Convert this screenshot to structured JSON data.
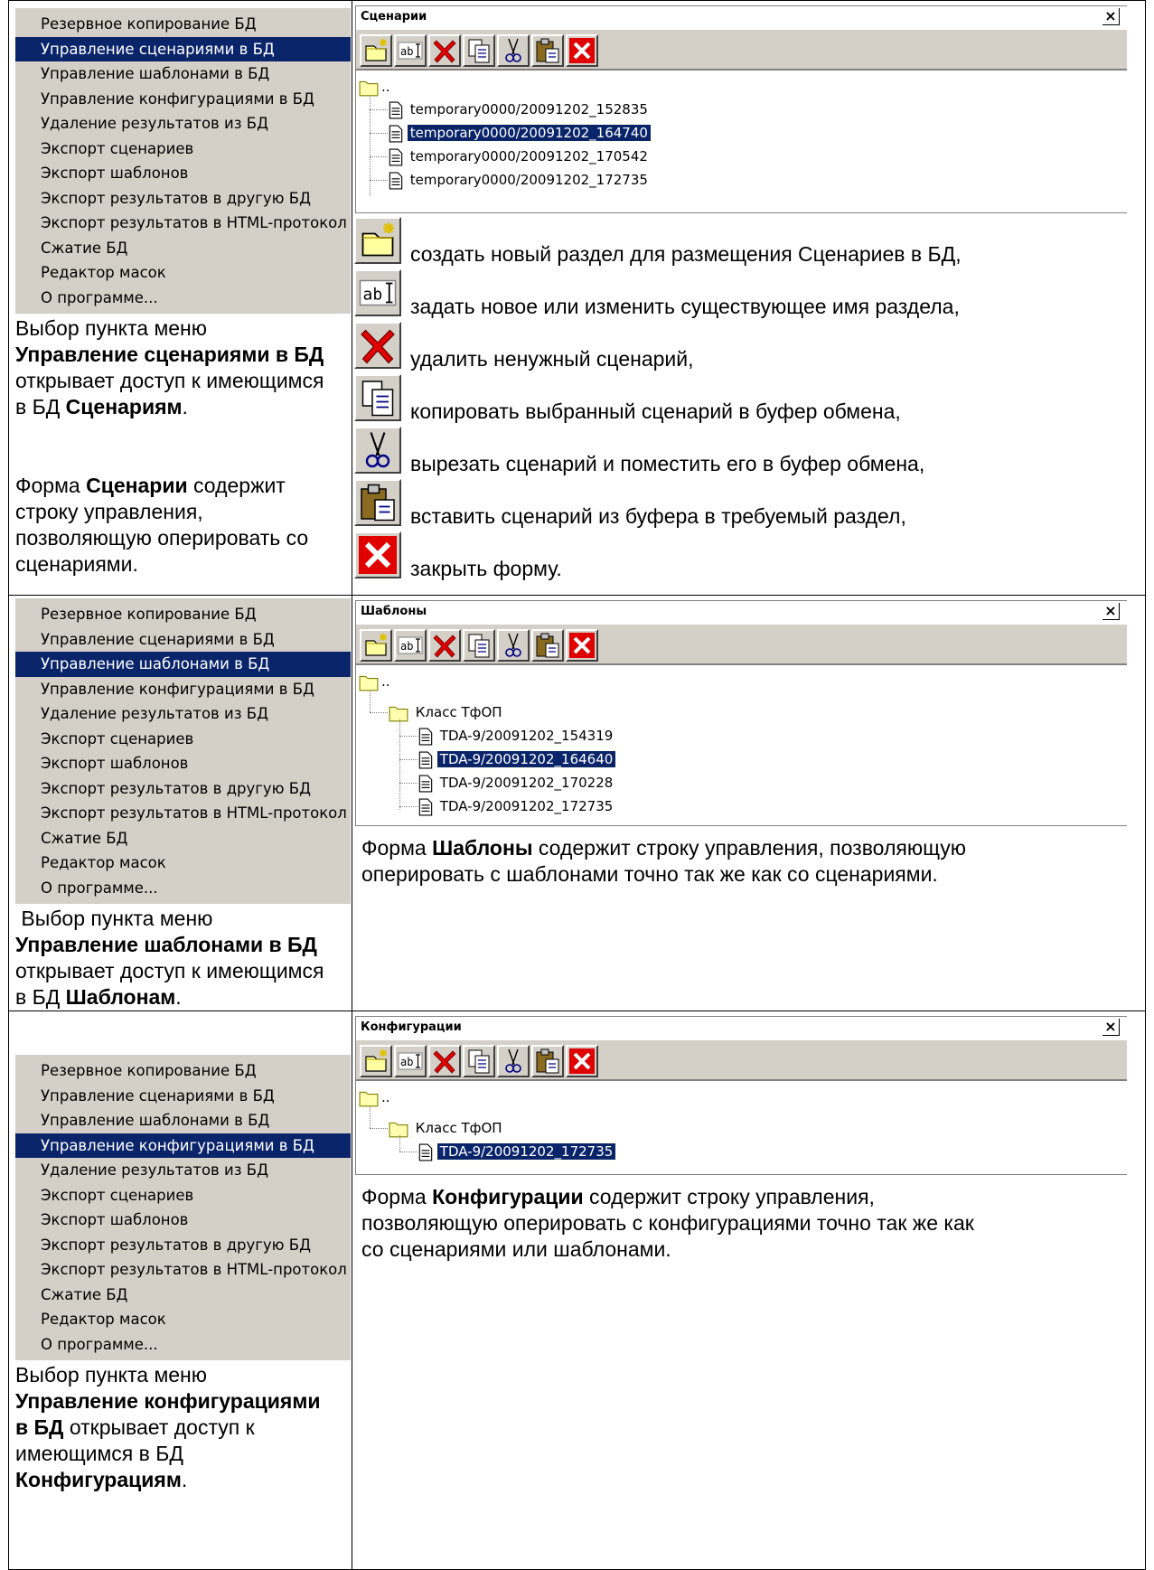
{
  "menu_items": [
    "Резервное копирование БД",
    "Управление сценариями в БД",
    "Управление шаблонами в БД",
    "Управление конфигурациями в БД",
    "Удаление результатов из БД",
    "Экспорт сценариев",
    "Экспорт шаблонов",
    "Экспорт результатов в другую БД",
    "Экспорт результатов в HTML-протокол",
    "Сжатие БД",
    "Редактор масок",
    "О программе..."
  ],
  "row1": {
    "desc": {
      "l1": "Выбор пункта меню",
      "b1": "Управление сценариями в БД",
      "l2": "открывает доступ к имеющимся",
      "l3a": "в БД ",
      "b2": "Сценариям",
      "l3c": "."
    },
    "desc2": {
      "a": "Форма ",
      "b": "Сценарии",
      "c": " содержит",
      "l2": "строку управления,",
      "l3": "позволяющую оперировать со",
      "l4": "сценариями."
    },
    "window_title": "Сценарии",
    "close_x": "×",
    "root": "..",
    "files": [
      "temporary0000/20091202_152835",
      "temporary0000/20091202_164740",
      "temporary0000/20091202_170542",
      "temporary0000/20091202_172735"
    ],
    "legend": [
      "создать новый раздел для размещения Сценариев в БД,",
      "задать новое или изменить существующее имя раздела,",
      "удалить ненужный сценарий,",
      "копировать выбранный сценарий в буфер обмена,",
      "вырезать сценарий и поместить его в буфер обмена,",
      "вставить сценарий из буфера в требуемый раздел,",
      "закрыть форму."
    ]
  },
  "row2": {
    "window_title": "Шаблоны",
    "root": "..",
    "folder": "Класс ТфОП",
    "files": [
      "TDA-9/20091202_154319",
      "TDA-9/20091202_164640",
      "TDA-9/20091202_170228",
      "TDA-9/20091202_172735"
    ],
    "para": {
      "a": "Форма ",
      "b": "Шаблоны",
      "c": " содержит строку управления, позволяющую",
      "l2": "оперировать с шаблонами точно так же как со сценариями."
    },
    "desc": {
      "l1": " Выбор пункта меню",
      "b1": "Управление шаблонами в БД",
      "l2": "открывает доступ к имеющимся",
      "l3a": "в БД ",
      "b2": "Шаблонам",
      "l3c": "."
    }
  },
  "row3": {
    "window_title": "Конфигурации",
    "root": "..",
    "folder": "Класс ТфОП",
    "files": [
      "TDA-9/20091202_172735"
    ],
    "para": {
      "a": "Форма ",
      "b": "Конфигурации",
      "c": " содержит строку управления,",
      "l2": "позволяющую оперировать с конфигурациями точно так же как",
      "l3": "со сценариями или шаблонами."
    },
    "desc": {
      "l1": "Выбор пункта меню",
      "b1": "Управление конфигурациями",
      "b1b": "в БД",
      "l2a": " открывает доступ к",
      "l3": "имеющимся в БД",
      "b2": "Конфигурациям",
      "l4c": "."
    }
  }
}
